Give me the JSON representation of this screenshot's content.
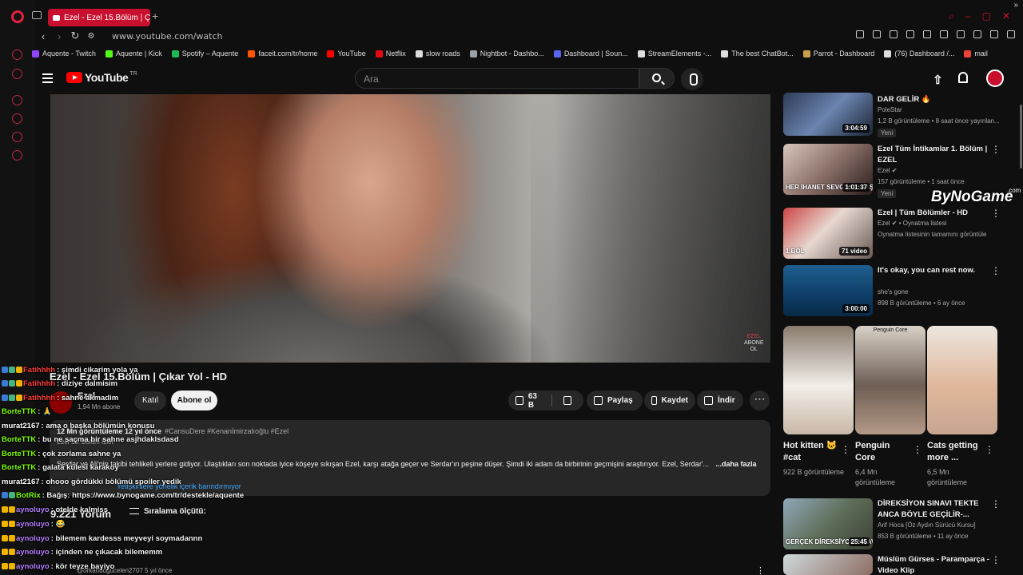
{
  "browser": {
    "tab_title": "Ezel - Ezel 15.Bölüm | Çıkar",
    "new_tab": "+",
    "url": "www.youtube.com/watch",
    "bookmarks": [
      {
        "label": "Aquente - Twitch",
        "color": "#9146ff"
      },
      {
        "label": "Aquente | Kick",
        "color": "#53fc18"
      },
      {
        "label": "Spotify – Aquente",
        "color": "#1db954"
      },
      {
        "label": "faceit.com/tr/home",
        "color": "#ff5500"
      },
      {
        "label": "YouTube",
        "color": "#ff0000"
      },
      {
        "label": "Netflix",
        "color": "#e50914"
      },
      {
        "label": "slow roads",
        "color": "#dddddd"
      },
      {
        "label": "Nightbot - Dashbo...",
        "color": "#9aa0a6"
      },
      {
        "label": "Dashboard | Soun...",
        "color": "#5865f2"
      },
      {
        "label": "StreamElements -...",
        "color": "#dddddd"
      },
      {
        "label": "The best ChatBot...",
        "color": "#dddddd"
      },
      {
        "label": "Parrot - Dashboard",
        "color": "#c8a24a"
      },
      {
        "label": "(76) Dashboard /...",
        "color": "#dddddd"
      },
      {
        "label": "mail",
        "color": "#ea4335"
      }
    ]
  },
  "youtube": {
    "logo_text": "YouTube",
    "country": "TR",
    "search_placeholder": "Ara"
  },
  "video": {
    "watermark_line1": "EZEL",
    "watermark_line2": "ABONE",
    "watermark_line3": "OL",
    "title": "Ezel - Ezel 15.Bölüm | Çıkar Yol - HD",
    "channel": "Ezel",
    "subscribers": "1,94 Mn abone",
    "join": "Katıl",
    "subscribe": "Abone ol",
    "likes": "63 B",
    "share": "Paylaş",
    "save": "Kaydet",
    "download": "İndir",
    "more": "⋯",
    "desc_meta": "12 Mn görüntüleme  12 yıl önce",
    "desc_tags": "#CansuDere #Kenanİmirzalıoğlu #Ezel",
    "desc_extra": "Ezel 15. Bölüm İzlet",
    "desc_text": "Serdar ve Ali'nin takibi tehlikeli yerlere gidiyor. Ulaştıkları son noktada iyice köşeye sıkışan Ezel, karşı atağa geçer ve Serdar'ın peşine düşer. Şimdi iki adam da birbirinin geçmişini araştırıyor. Ezel, Serdar'...",
    "desc_more": "...daha fazla",
    "age_note": "Yetişkinlere yönelik içerik barındırmıyor",
    "comments_count": "9.221 Yorum",
    "sort_label": "Sıralama ölçütü:",
    "first_comment_author": "@orkandogucelen2707",
    "first_comment_time": "5 yıl önce"
  },
  "chat": [
    {
      "user": "Fatihhhh",
      "msg": ": şimdi cikarim yola ya",
      "color": "#ff3b3b",
      "badges": [
        "#3a7bd5",
        "#43b581",
        "#f0b400"
      ]
    },
    {
      "user": "Fatihhhh",
      "msg": ": diziye dalmisim",
      "color": "#ff3b3b",
      "badges": [
        "#3a7bd5",
        "#43b581",
        "#f0b400"
      ]
    },
    {
      "user": "Fatihhhh",
      "msg": ": sahne akmadim",
      "color": "#ff3b3b",
      "badges": [
        "#3a7bd5",
        "#43b581",
        "#f0b400"
      ]
    },
    {
      "user": "BorteTTK",
      "msg": ": 🙏",
      "color": "#7cfc00",
      "badges": []
    },
    {
      "user": "murat2167",
      "msg": ": ama o başka bölümün konusu",
      "color": "#ffffff",
      "badges": []
    },
    {
      "user": "BorteTTK",
      "msg": ": bu ne saçma bir sahne asjhdaklsdasd",
      "color": "#7cfc00",
      "badges": []
    },
    {
      "user": "BorteTTK",
      "msg": ": çok zorlama sahne ya",
      "color": "#7cfc00",
      "badges": []
    },
    {
      "user": "BorteTTK",
      "msg": ": galata kulesi karaköy",
      "color": "#7cfc00",
      "badges": []
    },
    {
      "user": "murat2167",
      "msg": ": ohooo gördükki bölümü spoiler yedik",
      "color": "#ffffff",
      "badges": []
    },
    {
      "user": "BotRix",
      "msg": ": Bağış: https://www.bynogame.com/tr/destekle/aquente",
      "color": "#7cfc00",
      "badges": [
        "#3a7bd5",
        "#43b581"
      ]
    },
    {
      "user": "aynoluyo",
      "msg": ": otelde kalmiss",
      "color": "#b57cff",
      "badges": [
        "#f0b400",
        "#f0b400"
      ]
    },
    {
      "user": "aynoluyo",
      "msg": ": 😂",
      "color": "#b57cff",
      "badges": [
        "#f0b400",
        "#f0b400"
      ]
    },
    {
      "user": "aynoluyo",
      "msg": ": bilemem kardesss meyveyi soymadannn",
      "color": "#b57cff",
      "badges": [
        "#f0b400",
        "#f0b400"
      ]
    },
    {
      "user": "aynoluyo",
      "msg": ": içinden ne çıkacak bilememm",
      "color": "#b57cff",
      "badges": [
        "#f0b400",
        "#f0b400"
      ]
    },
    {
      "user": "aynoluyo",
      "msg": ": kör teyze bayiyo",
      "color": "#b57cff",
      "badges": [
        "#f0b400",
        "#f0b400"
      ]
    }
  ],
  "recommendations": [
    {
      "title": "DAR GELİR 🔥",
      "channel": "PoleStar",
      "meta": "1,2 B görüntüleme • 8 saat önce yayınlan...",
      "badge": "Yeni",
      "duration": "3:04:59"
    },
    {
      "title": "Ezel Tüm İntikamlar 1. Bölüm | EZEL",
      "channel": "Ezel ✔",
      "meta": "157 görüntüleme • 1 saat önce",
      "badge": "Yeni",
      "duration": "1:01:37",
      "thumb_text": "HER İHANET SEVGİYLE BAŞLAR"
    },
    {
      "title": "Ezel | Tüm Bölümler - HD",
      "channel": "Ezel ✔ • Oynatma listesi",
      "meta": "Oynatma listesinin tamamını görüntüle",
      "badge": "",
      "duration": "71 video",
      "thumb_text": "1.BÖL"
    },
    {
      "title": "It's okay, you can rest now.",
      "channel": "she's gone",
      "meta": "898 B görüntüleme • 6 ay önce",
      "badge": "",
      "duration": "3:00:00"
    },
    {
      "title": "DİREKSİYON SINAVI TEKTE ANCA BÖYLE GEÇİLİR-...",
      "channel": "Arif Hoca [Öz Aydın Sürücü Kursu]",
      "meta": "853 B görüntüleme • 11 ay önce",
      "badge": "",
      "duration": "25:45",
      "thumb_text": "GERÇEK DİREKSİYON SINAVI"
    },
    {
      "title": "Müslüm Gürses - Paramparça - Video Klip",
      "channel": "",
      "meta": "",
      "badge": "",
      "duration": ""
    }
  ],
  "overlay": {
    "brand": "ByNoGame",
    "brand_suffix": ".com"
  },
  "shorts": [
    {
      "title": "Hot kitten 🐱 #cat",
      "views": "922 B görüntüleme"
    },
    {
      "title": "Penguin Core",
      "views": "6,4 Mn görüntüleme",
      "thumb_text": "Penguin Core"
    },
    {
      "title": "Cats getting more ...",
      "views": "6,5 Mn görüntüleme"
    }
  ]
}
